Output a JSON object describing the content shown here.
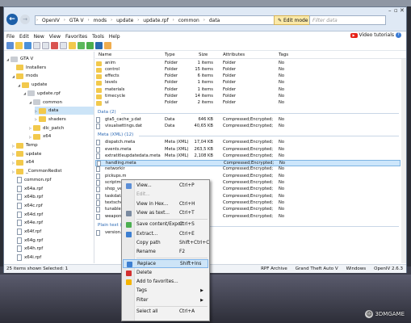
{
  "address": {
    "segments": [
      "OpenIV",
      "GTA V",
      "mods",
      "update",
      "update.rpf",
      "common",
      "data"
    ],
    "edit_mode": "Edit mode",
    "filter_placeholder": "Filter data"
  },
  "menubar": [
    "File",
    "Edit",
    "New",
    "View",
    "Favorites",
    "Tools",
    "Help"
  ],
  "video_tutorials": "Video tutorials",
  "tree": [
    {
      "label": "GTA V",
      "type": "pc",
      "arrow": "◢",
      "indent": 0
    },
    {
      "label": "Installers",
      "type": "folder",
      "arrow": "",
      "indent": 1
    },
    {
      "label": "mods",
      "type": "folder",
      "arrow": "◢",
      "indent": 1
    },
    {
      "label": "update",
      "type": "folder",
      "arrow": "◢",
      "indent": 2
    },
    {
      "label": "update.rpf",
      "type": "gray",
      "arrow": "◢",
      "indent": 3
    },
    {
      "label": "common",
      "type": "gray",
      "arrow": "◢",
      "indent": 4
    },
    {
      "label": "data",
      "type": "folder",
      "arrow": "▷",
      "indent": 5,
      "selected": true
    },
    {
      "label": "shaders",
      "type": "folder",
      "arrow": "▷",
      "indent": 5
    },
    {
      "label": "dlc_patch",
      "type": "folder",
      "arrow": "▷",
      "indent": 4
    },
    {
      "label": "x64",
      "type": "folder",
      "arrow": "▷",
      "indent": 4
    },
    {
      "label": "Temp",
      "type": "folder",
      "arrow": "▷",
      "indent": 1
    },
    {
      "label": "update",
      "type": "folder",
      "arrow": "▷",
      "indent": 1
    },
    {
      "label": "x64",
      "type": "folder",
      "arrow": "▷",
      "indent": 1
    },
    {
      "label": "_CommonRedist",
      "type": "folder",
      "arrow": "▷",
      "indent": 1
    },
    {
      "label": "common.rpf",
      "type": "file",
      "arrow": "",
      "indent": 1
    },
    {
      "label": "x64a.rpf",
      "type": "file",
      "arrow": "",
      "indent": 1
    },
    {
      "label": "x64b.rpf",
      "type": "file",
      "arrow": "",
      "indent": 1
    },
    {
      "label": "x64c.rpf",
      "type": "file",
      "arrow": "",
      "indent": 1
    },
    {
      "label": "x64d.rpf",
      "type": "file",
      "arrow": "",
      "indent": 1
    },
    {
      "label": "x64e.rpf",
      "type": "file",
      "arrow": "",
      "indent": 1
    },
    {
      "label": "x64f.rpf",
      "type": "file",
      "arrow": "",
      "indent": 1
    },
    {
      "label": "x64g.rpf",
      "type": "file",
      "arrow": "",
      "indent": 1
    },
    {
      "label": "x64h.rpf",
      "type": "file",
      "arrow": "",
      "indent": 1
    },
    {
      "label": "x64i.rpf",
      "type": "file",
      "arrow": "",
      "indent": 1
    }
  ],
  "columns": [
    "Name",
    "Type",
    "Size",
    "Attributes",
    "Tags"
  ],
  "folders": [
    {
      "name": "anim",
      "type": "Folder",
      "size": "1 items",
      "attr": "Folder",
      "tags": "No"
    },
    {
      "name": "control",
      "type": "Folder",
      "size": "15 items",
      "attr": "Folder",
      "tags": "No"
    },
    {
      "name": "effects",
      "type": "Folder",
      "size": "6 items",
      "attr": "Folder",
      "tags": "No"
    },
    {
      "name": "levels",
      "type": "Folder",
      "size": "1 items",
      "attr": "Folder",
      "tags": "No"
    },
    {
      "name": "materials",
      "type": "Folder",
      "size": "1 items",
      "attr": "Folder",
      "tags": "No"
    },
    {
      "name": "timecycle",
      "type": "Folder",
      "size": "14 items",
      "attr": "Folder",
      "tags": "No"
    },
    {
      "name": "ui",
      "type": "Folder",
      "size": "2 items",
      "attr": "Folder",
      "tags": "No"
    }
  ],
  "group_data": "Data (2)",
  "data_files": [
    {
      "name": "gta5_cache_y.dat",
      "type": "Data",
      "size": "646 KB",
      "attr": "Compressed;Encrypted;",
      "tags": "No"
    },
    {
      "name": "visualsettings.dat",
      "type": "Data",
      "size": "40,65 KB",
      "attr": "Compressed;Encrypted;",
      "tags": "No"
    }
  ],
  "group_meta": "Meta (XML) (12)",
  "meta_files": [
    {
      "name": "dispatch.meta",
      "type": "Meta (XML)",
      "size": "17,04 KB",
      "attr": "Compressed;Encrypted;",
      "tags": "No"
    },
    {
      "name": "events.meta",
      "type": "Meta (XML)",
      "size": "263,5 KB",
      "attr": "Compressed;Encrypted;",
      "tags": "No"
    },
    {
      "name": "extratitleupdatedata.meta",
      "type": "Meta (XML)",
      "size": "2,108 KB",
      "attr": "Compressed;Encrypted;",
      "tags": "No"
    },
    {
      "name": "handling.meta",
      "type": "",
      "size": "",
      "attr": "Compressed;Encrypted;",
      "tags": "No",
      "selected": true
    },
    {
      "name": "networkir",
      "type": "",
      "size": "",
      "attr": "Compressed;Encrypted;",
      "tags": "No"
    },
    {
      "name": "pickups.m",
      "type": "",
      "size": "",
      "attr": "Compressed;Encrypted;",
      "tags": "No"
    },
    {
      "name": "scriptmet",
      "type": "",
      "size": "",
      "attr": "Compressed;Encrypted;",
      "tags": "No"
    },
    {
      "name": "shop_veh",
      "type": "",
      "size": "",
      "attr": "Compressed;Encrypted;",
      "tags": "No"
    },
    {
      "name": "taskdata.",
      "type": "",
      "size": "",
      "attr": "Compressed;Encrypted;",
      "tags": "No"
    },
    {
      "name": "textsche",
      "type": "",
      "size": "",
      "attr": "Compressed;Encrypted;",
      "tags": "No"
    },
    {
      "name": "tunablesb",
      "type": "",
      "size": "",
      "attr": "Compressed;Encrypted;",
      "tags": "No"
    },
    {
      "name": "weaponar",
      "type": "",
      "size": "",
      "attr": "Compressed;Encrypted;",
      "tags": "No"
    }
  ],
  "group_plain": "Plain text (",
  "plain_files": [
    {
      "name": "version.tx",
      "type": "",
      "size": "",
      "attr": "",
      "tags": ""
    }
  ],
  "status": {
    "left": "25 items shown   Selected: 1",
    "right": [
      "RPF Archive",
      "Grand Theft Auto V",
      "Windows",
      "OpenIV 2.6.3"
    ]
  },
  "context_menu": [
    {
      "label": "View...",
      "shortcut": "Ctrl+P",
      "icon": "view-icon",
      "color": "#5b8ed6"
    },
    {
      "label": "Edit...",
      "shortcut": "",
      "icon": "",
      "disabled": true
    },
    {
      "label": "View in Hex...",
      "shortcut": "Ctrl+H",
      "icon": "",
      "color": ""
    },
    {
      "label": "View as text...",
      "shortcut": "Ctrl+T",
      "icon": "text-icon",
      "color": "#7a8aa0"
    },
    {
      "sep": true
    },
    {
      "label": "Save content/Export",
      "shortcut": "Ctrl+S",
      "icon": "save-icon",
      "color": "#4caf50"
    },
    {
      "label": "Extract...",
      "shortcut": "Ctrl+E",
      "icon": "extract-icon",
      "color": "#3d7fd1"
    },
    {
      "label": "Copy path",
      "shortcut": "Shift+Ctrl+C",
      "icon": "",
      "color": ""
    },
    {
      "label": "Rename",
      "shortcut": "F2",
      "icon": "",
      "color": ""
    },
    {
      "sep": true
    },
    {
      "label": "Replace",
      "shortcut": "Shift+Ins",
      "icon": "replace-icon",
      "color": "#3d7fd1",
      "hover": true
    },
    {
      "label": "Delete",
      "shortcut": "",
      "icon": "delete-icon",
      "color": "#d32f2f"
    },
    {
      "label": "Add to favorites...",
      "shortcut": "",
      "icon": "star-icon",
      "color": "#f5b400"
    },
    {
      "label": "Tags",
      "shortcut": "",
      "icon": "",
      "color": "",
      "submenu": true
    },
    {
      "label": "Filter",
      "shortcut": "",
      "icon": "",
      "color": "",
      "submenu": true
    },
    {
      "sep": true
    },
    {
      "label": "Select all",
      "shortcut": "Ctrl+A",
      "icon": "",
      "color": ""
    }
  ],
  "watermark": "3DMGAME"
}
